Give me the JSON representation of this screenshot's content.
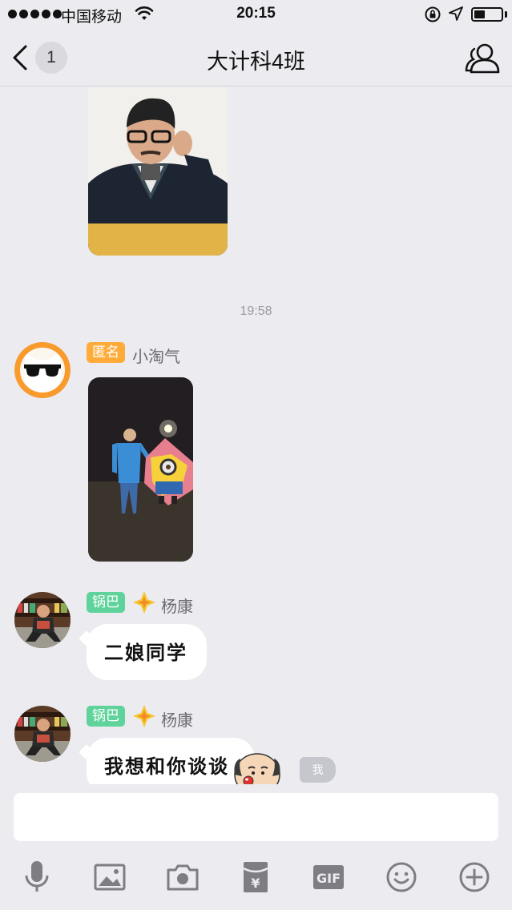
{
  "status_bar": {
    "carrier": "中国移动",
    "time": "20:15",
    "battery_level": 0.4
  },
  "nav": {
    "back_count": "1",
    "title": "大计科4班"
  },
  "chat": {
    "timestamp": "19:58",
    "messages": [
      {
        "badge": "匿名",
        "badge_color": "#ffab3a",
        "sender": "小淘气",
        "type": "image"
      },
      {
        "badge": "锅巴",
        "badge_color": "#5fd39b",
        "sender": "杨康",
        "type": "text",
        "text": "二娘同学"
      },
      {
        "badge": "锅巴",
        "badge_color": "#5fd39b",
        "sender": "杨康",
        "type": "text",
        "text": "我想和你谈谈"
      }
    ],
    "me_label": "我"
  },
  "input": {
    "placeholder": ""
  },
  "toolbar": {
    "items": [
      "microphone-icon",
      "image-icon",
      "camera-icon",
      "red-packet-icon",
      "gif-icon",
      "emoji-icon",
      "plus-icon"
    ],
    "gif_label": "GIF",
    "red_packet_label": "¥"
  }
}
